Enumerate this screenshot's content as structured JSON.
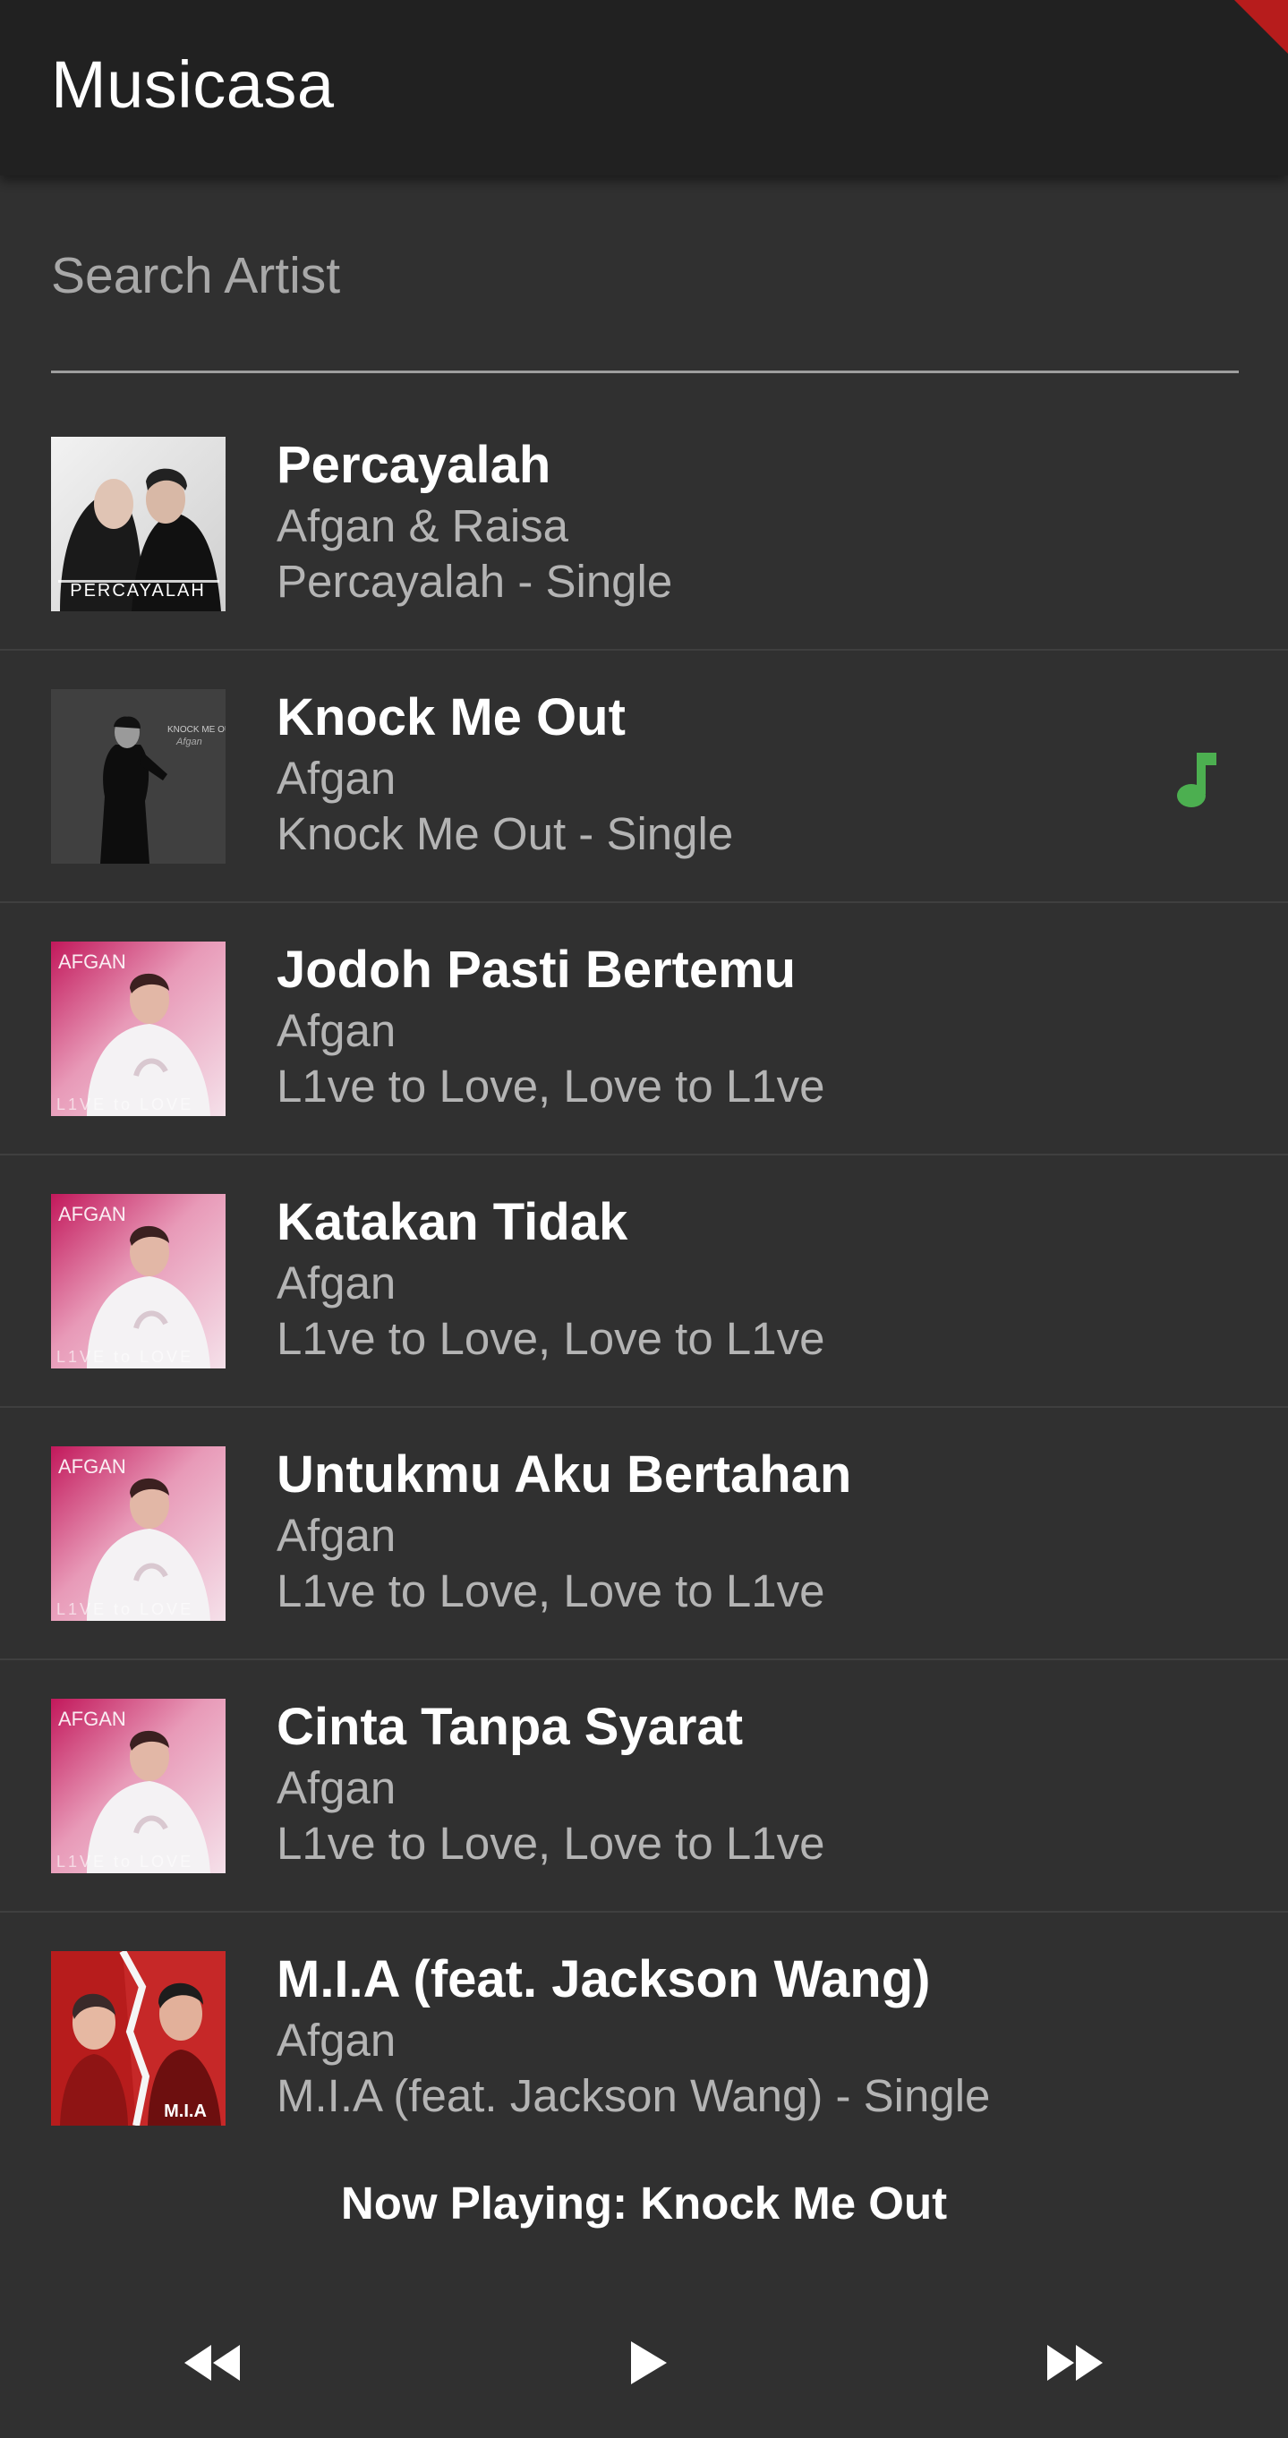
{
  "app": {
    "title": "Musicasa",
    "accent_color": "#4caf50"
  },
  "search": {
    "placeholder": "Search Artist",
    "value": ""
  },
  "songs": [
    {
      "title": "Percayalah",
      "artist": "Afgan & Raisa",
      "album": "Percayalah - Single",
      "art": "percayalah",
      "playing": false
    },
    {
      "title": "Knock Me Out",
      "artist": "Afgan",
      "album": "Knock Me Out - Single",
      "art": "knockmeout",
      "playing": true
    },
    {
      "title": "Jodoh Pasti Bertemu",
      "artist": "Afgan",
      "album": "L1ve to Love, Love to L1ve",
      "art": "l1ve",
      "playing": false
    },
    {
      "title": "Katakan Tidak",
      "artist": "Afgan",
      "album": "L1ve to Love, Love to L1ve",
      "art": "l1ve",
      "playing": false
    },
    {
      "title": "Untukmu Aku Bertahan",
      "artist": "Afgan",
      "album": "L1ve to Love, Love to L1ve",
      "art": "l1ve",
      "playing": false
    },
    {
      "title": "Cinta Tanpa Syarat",
      "artist": "Afgan",
      "album": "L1ve to Love, Love to L1ve",
      "art": "l1ve",
      "playing": false
    },
    {
      "title": "M.I.A (feat. Jackson Wang)",
      "artist": "Afgan",
      "album": "M.I.A (feat. Jackson Wang) - Single",
      "art": "mia",
      "playing": false
    }
  ],
  "player": {
    "now_playing_label": "Now Playing: Knock Me Out",
    "icons": {
      "previous": "fast-rewind-icon",
      "play": "play-icon",
      "next": "fast-forward-icon",
      "now_playing_indicator": "music-note-icon"
    }
  }
}
